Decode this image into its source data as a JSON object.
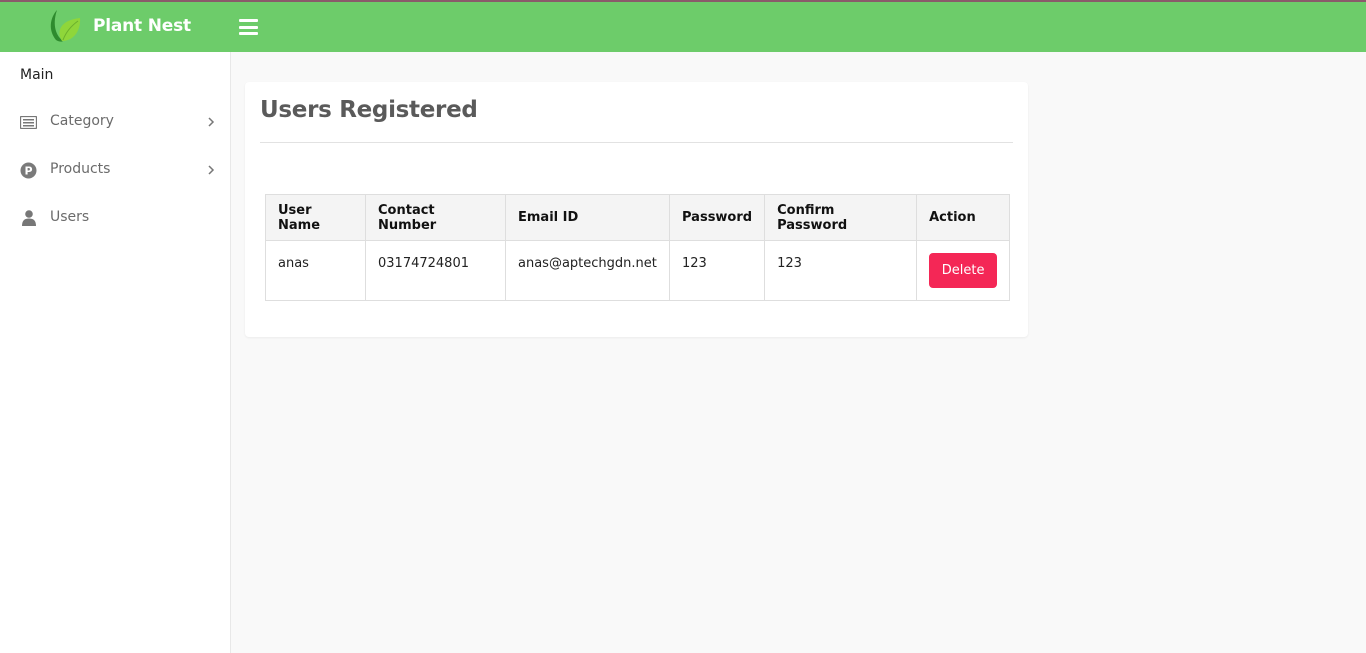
{
  "app": {
    "brand_name": "Plant Nest"
  },
  "sidebar": {
    "section_title": "Main",
    "items": [
      {
        "label": "Category",
        "icon": "list-icon",
        "has_submenu": true
      },
      {
        "label": "Products",
        "icon": "p-circle-icon",
        "has_submenu": true
      },
      {
        "label": "Users",
        "icon": "user-icon",
        "has_submenu": false
      }
    ]
  },
  "main": {
    "title": "Users Registered",
    "table": {
      "headers": [
        "User Name",
        "Contact Number",
        "Email ID",
        "Password",
        "Confirm Password",
        "Action"
      ],
      "rows": [
        {
          "user_name": "anas",
          "contact_number": "03174724801",
          "email": "anas@aptechgdn.net",
          "password": "123",
          "confirm_password": "123",
          "action_label": "Delete"
        }
      ]
    }
  },
  "colors": {
    "topbar": "#6dcc6a",
    "delete_button": "#f42756"
  }
}
